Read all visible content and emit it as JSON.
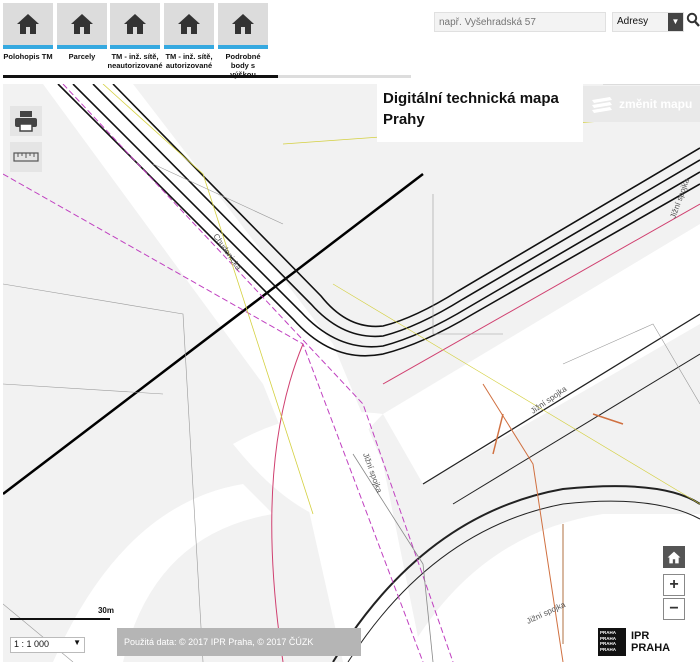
{
  "layers": [
    {
      "label": "Polohopis TM",
      "icon": "home-icon",
      "active": true
    },
    {
      "label": "Parcely",
      "icon": "home-icon",
      "active": true
    },
    {
      "label": "TM - inž. sítě, neautorizované",
      "icon": "home-icon",
      "active": true
    },
    {
      "label": "TM - inž. sítě, autorizované",
      "icon": "home-icon",
      "active": true
    },
    {
      "label": "Podrobné body s výškou",
      "icon": "home-icon",
      "active": true
    }
  ],
  "search": {
    "placeholder": "např. Vyšehradská 57",
    "type_value": "Adresy",
    "icon": "search-icon"
  },
  "header": {
    "title": "Digitální technická mapa Prahy",
    "change_map_label": "změnit mapu"
  },
  "map": {
    "street_labels": [
      "Chudenická",
      "Jižní spojka",
      "Jižní spojka",
      "Jižní spojka",
      "Jižní spojka"
    ],
    "scale_bar_label": "30m",
    "scale_value": "1 : 1 000",
    "attribution": "Použitá data: © 2017 IPR Praha, © 2017 ČÚZK",
    "logo_seal": "PRAHA PRAHA PRAHA PRAHA",
    "logo_text": "IPR PRAHA"
  },
  "tools": {
    "print_icon": "print-icon",
    "measure_icon": "ruler-icon",
    "home_icon": "home-icon",
    "zoom_in": "+",
    "zoom_out": "−"
  },
  "colors": {
    "accent": "#36a9e0",
    "tile": "#dcdcdc",
    "map_bg": "#f2f2f2"
  }
}
